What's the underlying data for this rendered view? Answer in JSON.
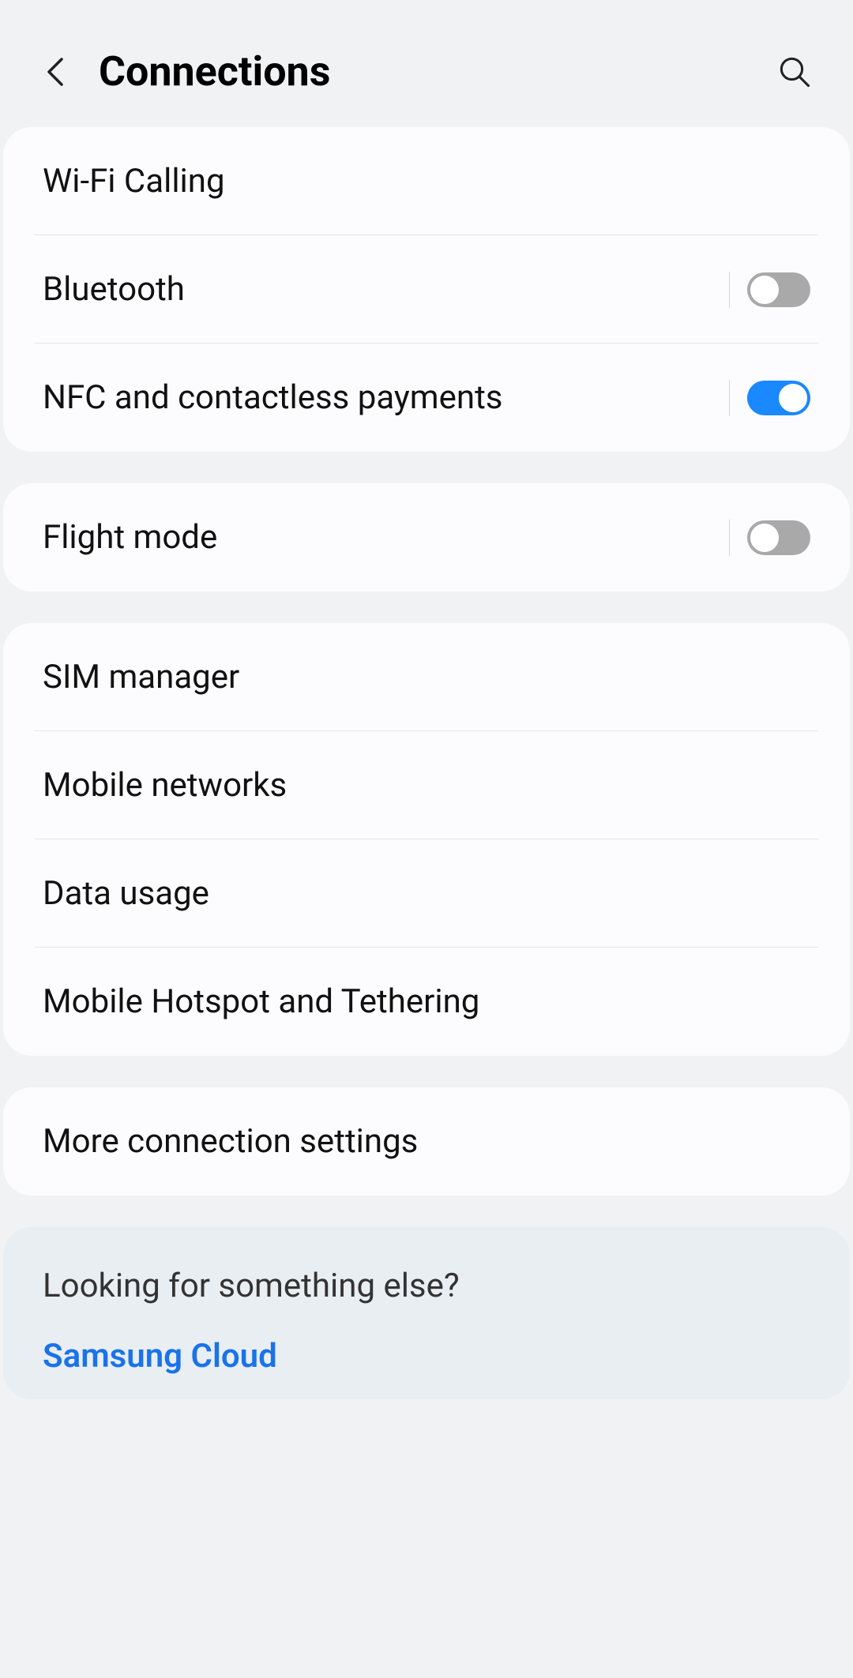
{
  "header": {
    "title": "Connections"
  },
  "group1": {
    "items": [
      {
        "label": "Wi-Fi Calling",
        "has_toggle": false
      },
      {
        "label": "Bluetooth",
        "has_toggle": true,
        "on": false
      },
      {
        "label": "NFC and contactless payments",
        "has_toggle": true,
        "on": true
      }
    ]
  },
  "group2": {
    "items": [
      {
        "label": "Flight mode",
        "has_toggle": true,
        "on": false
      }
    ]
  },
  "group3": {
    "items": [
      {
        "label": "SIM manager"
      },
      {
        "label": "Mobile networks"
      },
      {
        "label": "Data usage"
      },
      {
        "label": "Mobile Hotspot and Tethering"
      }
    ]
  },
  "group4": {
    "items": [
      {
        "label": "More connection settings"
      }
    ]
  },
  "discover": {
    "title": "Looking for something else?",
    "link": "Samsung Cloud"
  }
}
